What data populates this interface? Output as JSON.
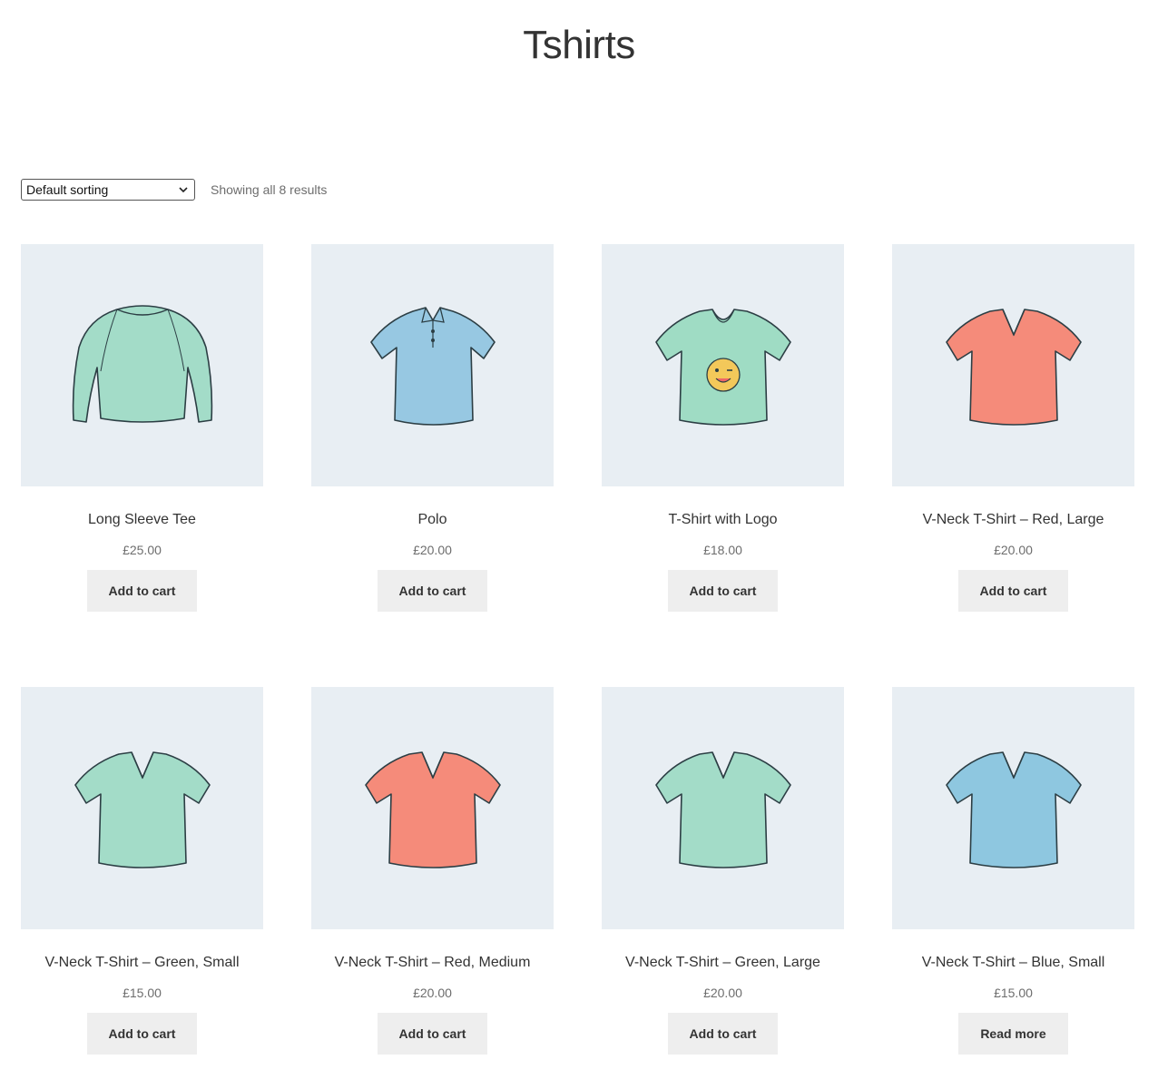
{
  "page": {
    "title": "Tshirts"
  },
  "toolbar": {
    "sort_selected": "Default sorting",
    "result_count": "Showing all 8 results"
  },
  "colors": {
    "thumb_bg": "#e8eef3",
    "button_bg": "#eeeeee",
    "green_shirt": "#9fdcc4",
    "blue_shirt": "#8ec7e0",
    "red_shirt": "#f4897a",
    "text": "#333333",
    "muted": "#6d6d6d"
  },
  "products": [
    {
      "name": "Long Sleeve Tee",
      "price": "£25.00",
      "button": "Add to cart",
      "icon": "long-sleeve-shirt-icon",
      "color": "#a3dcc8"
    },
    {
      "name": "Polo",
      "price": "£20.00",
      "button": "Add to cart",
      "icon": "polo-shirt-icon",
      "color": "#97c8e2"
    },
    {
      "name": "T-Shirt with Logo",
      "price": "£18.00",
      "button": "Add to cart",
      "icon": "logo-tshirt-icon",
      "color": "#9fdcc4"
    },
    {
      "name": "V-Neck T-Shirt – Red, Large",
      "price": "£20.00",
      "button": "Add to cart",
      "icon": "vneck-tshirt-icon",
      "color": "#f58b7a"
    },
    {
      "name": "V-Neck T-Shirt – Green, Small",
      "price": "£15.00",
      "button": "Add to cart",
      "icon": "vneck-tshirt-icon",
      "color": "#a3dcc8"
    },
    {
      "name": "V-Neck T-Shirt – Red, Medium",
      "price": "£20.00",
      "button": "Add to cart",
      "icon": "vneck-tshirt-icon",
      "color": "#f58b7a"
    },
    {
      "name": "V-Neck T-Shirt – Green, Large",
      "price": "£20.00",
      "button": "Add to cart",
      "icon": "vneck-tshirt-icon",
      "color": "#a3dcc8"
    },
    {
      "name": "V-Neck T-Shirt – Blue, Small",
      "price": "£15.00",
      "button": "Read more",
      "icon": "vneck-tshirt-icon",
      "color": "#8ec7e0"
    }
  ]
}
